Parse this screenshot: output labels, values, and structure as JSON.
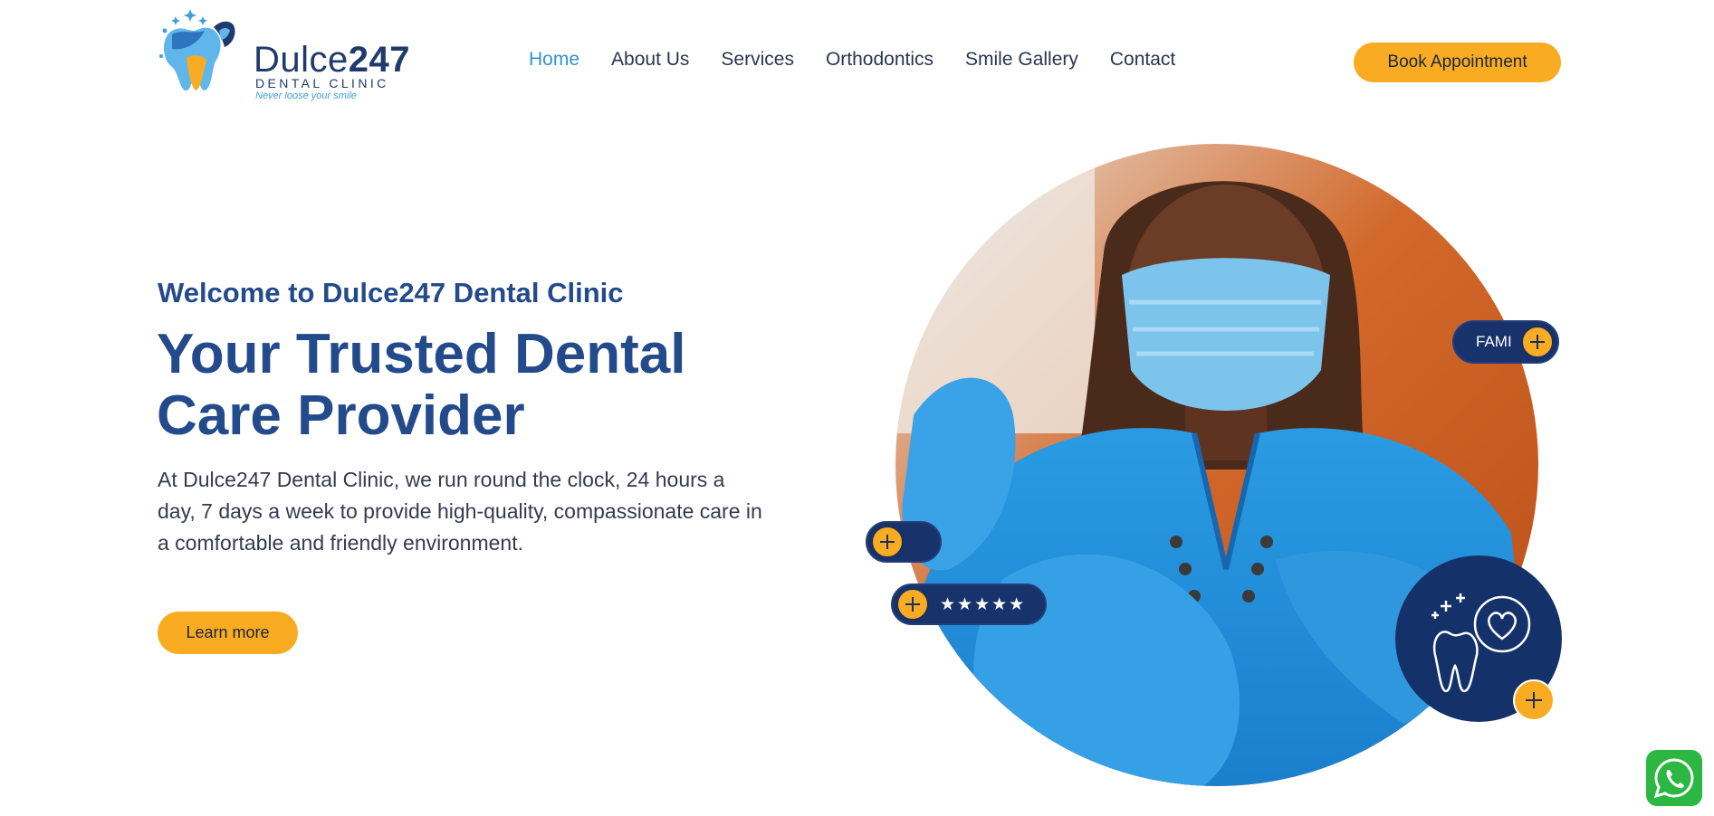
{
  "brand": {
    "name_light": "Dulce",
    "name_bold": "247",
    "subtitle": "DENTAL CLINIC",
    "tagline": "Never loose your smile",
    "logo_icon": "tooth-logo-icon"
  },
  "nav": {
    "items": [
      {
        "label": "Home",
        "active": true
      },
      {
        "label": "About Us",
        "active": false
      },
      {
        "label": "Services",
        "active": false
      },
      {
        "label": "Orthodontics",
        "active": false
      },
      {
        "label": "Smile Gallery",
        "active": false
      },
      {
        "label": "Contact",
        "active": false
      }
    ]
  },
  "header": {
    "book_label": "Book Appointment"
  },
  "hero": {
    "eyebrow": "Welcome to Dulce247 Dental Clinic",
    "title": "Your Trusted Dental Care Provider",
    "description": "At Dulce247 Dental Clinic, we run round the clock, 24 hours a day, 7 days a week to provide high-quality, compassionate care in a comfortable and friendly environment.",
    "learn_label": "Learn more",
    "image_alt": "dentist-photo"
  },
  "floating": {
    "family_label": "FAMI",
    "stars": "★★★★★",
    "rating": 5,
    "badge_icon": "tooth-heart-icon"
  },
  "colors": {
    "primary": "#234a8a",
    "accent": "#f9ac22",
    "nav_active": "#3393cf",
    "dark_navy": "#14316a",
    "whatsapp": "#2bb741"
  },
  "widgets": {
    "whatsapp_icon": "whatsapp-icon"
  }
}
